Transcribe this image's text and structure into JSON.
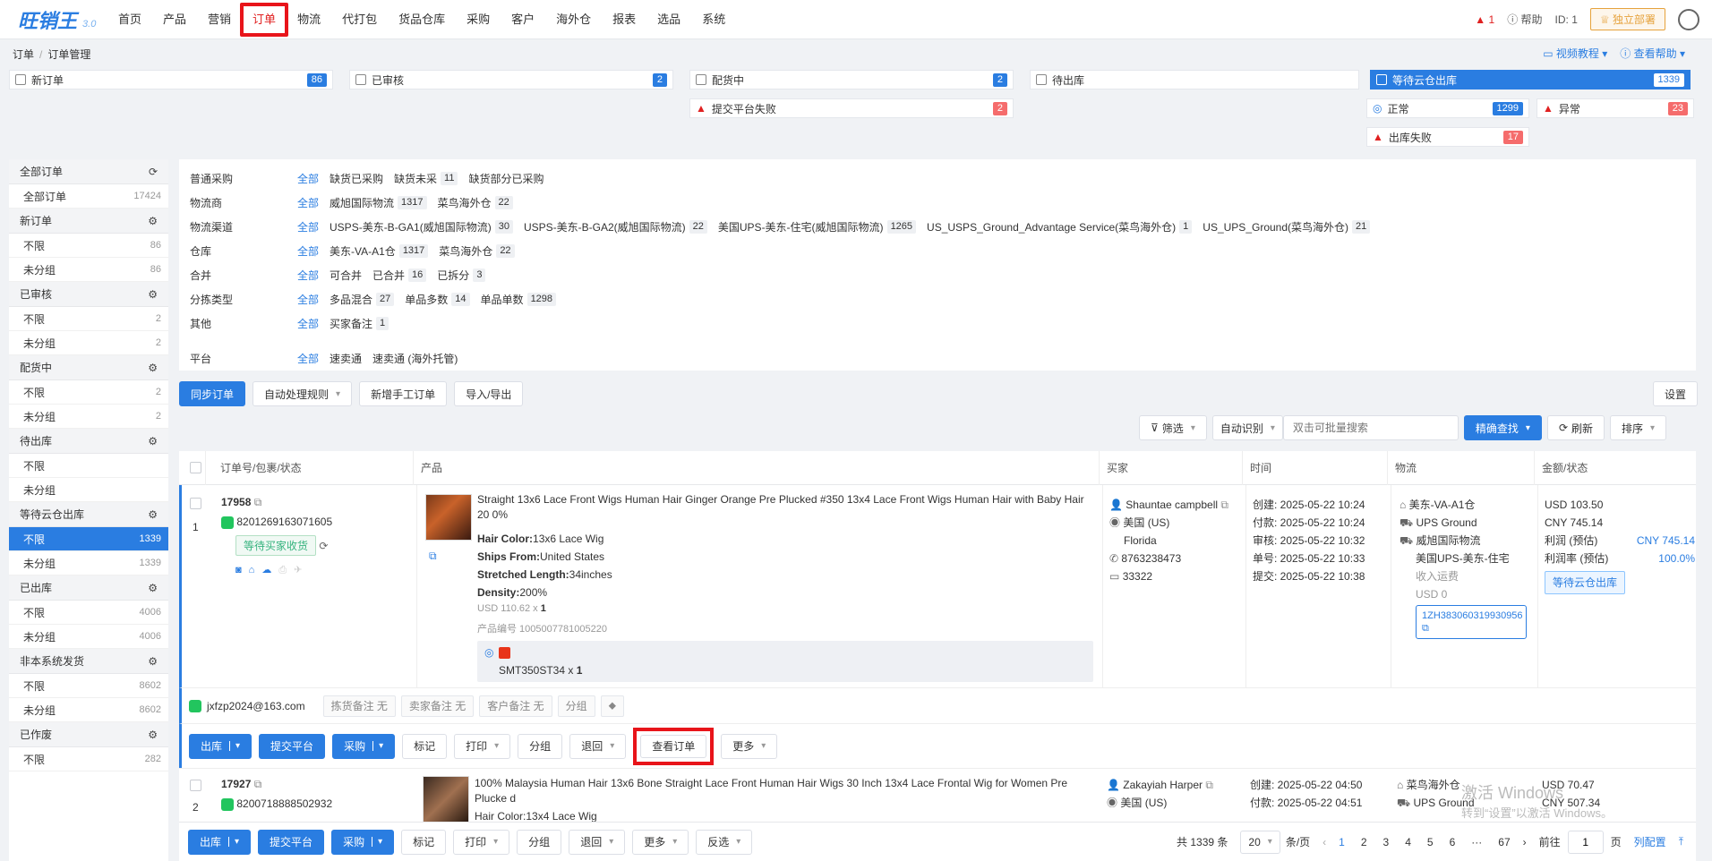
{
  "app": {
    "logo": "旺销王",
    "version": "3.0"
  },
  "nav": [
    "首页",
    "产品",
    "营销",
    "订单",
    "物流",
    "代打包",
    "货品仓库",
    "采购",
    "客户",
    "海外仓",
    "报表",
    "选品",
    "系统"
  ],
  "top": {
    "alert": "1",
    "help": "帮助",
    "id": "ID: 1",
    "deploy": "独立部署"
  },
  "breadcrumb": [
    "订单",
    "订单管理"
  ],
  "helpers": {
    "video": "视频教程",
    "help": "查看帮助"
  },
  "steps": [
    {
      "label": "新订单",
      "count": "86"
    },
    {
      "label": "已审核",
      "count": "2"
    },
    {
      "label": "配货中",
      "count": "2"
    },
    {
      "label": "待出库",
      "count": ""
    },
    {
      "label": "等待云仓出库",
      "count": "1339"
    }
  ],
  "substeps": {
    "fail_submit": {
      "label": "提交平台失败",
      "count": "2"
    },
    "normal": {
      "label": "正常",
      "count": "1299"
    },
    "abnormal": {
      "label": "异常",
      "count": "23"
    },
    "out_fail": {
      "label": "出库失败",
      "count": "17"
    }
  },
  "sidebar": [
    {
      "group": "全部订单",
      "items": [
        {
          "label": "全部订单",
          "count": "17424"
        }
      ]
    },
    {
      "group": "新订单",
      "items": [
        {
          "label": "不限",
          "count": "86"
        },
        {
          "label": "未分组",
          "count": "86"
        }
      ]
    },
    {
      "group": "已审核",
      "items": [
        {
          "label": "不限",
          "count": "2"
        },
        {
          "label": "未分组",
          "count": "2"
        }
      ]
    },
    {
      "group": "配货中",
      "items": [
        {
          "label": "不限",
          "count": "2"
        },
        {
          "label": "未分组",
          "count": "2"
        }
      ]
    },
    {
      "group": "待出库",
      "items": [
        {
          "label": "不限",
          "count": ""
        },
        {
          "label": "未分组",
          "count": ""
        }
      ]
    },
    {
      "group": "等待云仓出库",
      "items": [
        {
          "label": "不限",
          "count": "1339"
        },
        {
          "label": "未分组",
          "count": "1339"
        }
      ]
    },
    {
      "group": "已出库",
      "items": [
        {
          "label": "不限",
          "count": "4006"
        },
        {
          "label": "未分组",
          "count": "4006"
        }
      ]
    },
    {
      "group": "非本系统发货",
      "items": [
        {
          "label": "不限",
          "count": "8602"
        },
        {
          "label": "未分组",
          "count": "8602"
        }
      ]
    },
    {
      "group": "已作废",
      "items": [
        {
          "label": "不限",
          "count": "282"
        }
      ]
    }
  ],
  "filters": [
    {
      "label": "普通采购",
      "all": "全部",
      "chips": [
        {
          "t": "缺货已采购",
          "c": ""
        },
        {
          "t": "缺货未采",
          "c": "11"
        },
        {
          "t": "缺货部分已采购",
          "c": ""
        }
      ]
    },
    {
      "label": "物流商",
      "all": "全部",
      "chips": [
        {
          "t": "威旭国际物流",
          "c": "1317"
        },
        {
          "t": "菜鸟海外仓",
          "c": "22"
        }
      ]
    },
    {
      "label": "物流渠道",
      "all": "全部",
      "chips": [
        {
          "t": "USPS-美东-B-GA1(威旭国际物流)",
          "c": "30"
        },
        {
          "t": "USPS-美东-B-GA2(威旭国际物流)",
          "c": "22"
        },
        {
          "t": "美国UPS-美东-住宅(威旭国际物流)",
          "c": "1265"
        },
        {
          "t": "US_USPS_Ground_Advantage Service(菜鸟海外仓)",
          "c": "1"
        },
        {
          "t": "US_UPS_Ground(菜鸟海外仓)",
          "c": "21"
        }
      ]
    },
    {
      "label": "仓库",
      "all": "全部",
      "chips": [
        {
          "t": "美东-VA-A1仓",
          "c": "1317"
        },
        {
          "t": "菜鸟海外仓",
          "c": "22"
        }
      ]
    },
    {
      "label": "合并",
      "all": "全部",
      "chips": [
        {
          "t": "可合并",
          "c": ""
        },
        {
          "t": "已合并",
          "c": "16"
        },
        {
          "t": "已拆分",
          "c": "3"
        }
      ]
    },
    {
      "label": "分拣类型",
      "all": "全部",
      "chips": [
        {
          "t": "多品混合",
          "c": "27"
        },
        {
          "t": "单品多数",
          "c": "14"
        },
        {
          "t": "单品单数",
          "c": "1298"
        }
      ]
    },
    {
      "label": "其他",
      "all": "全部",
      "chips": [
        {
          "t": "买家备注",
          "c": "1"
        }
      ]
    },
    {
      "label": "平台",
      "all": "全部",
      "chips": [
        {
          "t": "速卖通",
          "c": ""
        },
        {
          "t": "速卖通 (海外托管)",
          "c": ""
        }
      ]
    }
  ],
  "toolbar": {
    "sync": "同步订单",
    "auto": "自动处理规则",
    "manual": "新增手工订单",
    "io": "导入/导出",
    "settings": "设置"
  },
  "search": {
    "filter": "筛选",
    "auto": "自动识别",
    "placeholder": "双击可批量搜索",
    "exact": "精确查找",
    "refresh": "刷新",
    "sort": "排序"
  },
  "columns": [
    "订单号/包裹/状态",
    "产品",
    "买家",
    "时间",
    "物流",
    "金额/状态"
  ],
  "order1": {
    "idx": "1",
    "id": "17958",
    "pkg": "8201269163071605",
    "status": "等待买家收货",
    "title": "Straight 13x6 Lace Front Wigs Human Hair Ginger Orange Pre Plucked #350 13x4 Lace Front Wigs Human Hair with Baby Hair 20 0%",
    "attrs": [
      {
        "k": "Hair Color:",
        "v": "13x6 Lace Wig"
      },
      {
        "k": "Ships From:",
        "v": "United States"
      },
      {
        "k": "Stretched Length:",
        "v": "34inches"
      },
      {
        "k": "Density:",
        "v": "200%"
      }
    ],
    "price": "USD 110.62 x",
    "qty": "1",
    "code": "产品编号  1005007781005220",
    "sku": "SMT350ST34 x",
    "sku_qty": "1",
    "buyer": {
      "name": "Shauntae campbell",
      "country": "美国 (US)",
      "state": "Florida",
      "phone": "8763238473",
      "zip": "33322"
    },
    "times": [
      "创建: 2025-05-22 10:24",
      "付款: 2025-05-22 10:24",
      "审核: 2025-05-22 10:32",
      "单号: 2025-05-22 10:33",
      "提交: 2025-05-22 10:38"
    ],
    "logistics": {
      "wh": "美东-VA-A1仓",
      "carrier": "UPS Ground",
      "provider": "威旭国际物流",
      "channel": "美国UPS-美东-住宅",
      "fee_label": "收入运费",
      "fee": "USD 0",
      "track": "1ZH383060319930956"
    },
    "amount": {
      "usd": "USD 103.50",
      "cny": "CNY 745.14",
      "profit_label": "利润  (预估)",
      "profit": "CNY 745.14",
      "rate_label": "利润率  (预估)",
      "rate": "100.0%",
      "status": "等待云仓出库"
    },
    "email": "jxfzp2024@163.com",
    "notes": [
      "拣货备注 无",
      "卖家备注 无",
      "客户备注 无",
      "分组"
    ]
  },
  "actions": [
    "出库",
    "提交平台",
    "采购",
    "标记",
    "打印",
    "分组",
    "退回",
    "查看订单",
    "更多"
  ],
  "order2": {
    "idx": "2",
    "id": "17927",
    "pkg": "8200718888502932",
    "title": "100% Malaysia Human Hair 13x6 Bone Straight Lace Front Human Hair Wigs 30 Inch 13x4 Lace Frontal Wig for Women Pre Plucke d",
    "attr": "Hair Color:13x4 Lace Wig",
    "buyer": "Zakayiah Harper",
    "country": "美国 (US)",
    "t1": "创建: 2025-05-22 04:50",
    "t2": "付款: 2025-05-22 04:51",
    "wh": "菜鸟海外仓",
    "carrier": "UPS Ground",
    "usd": "USD 70.47",
    "cny": "CNY 507.34"
  },
  "bottom": [
    "出库",
    "提交平台",
    "采购",
    "标记",
    "打印",
    "分组",
    "退回",
    "更多",
    "反选"
  ],
  "pager": {
    "total": "共 1339 条",
    "size": "20",
    "per": "条/页",
    "pages": [
      "1",
      "2",
      "3",
      "4",
      "5",
      "6",
      "···",
      "67"
    ],
    "goto": "前往",
    "page": "1",
    "unit": "页",
    "cols": "列配置"
  },
  "watermark": {
    "l1": "激活 Windows",
    "l2": "转到“设置”以激活 Windows。"
  }
}
